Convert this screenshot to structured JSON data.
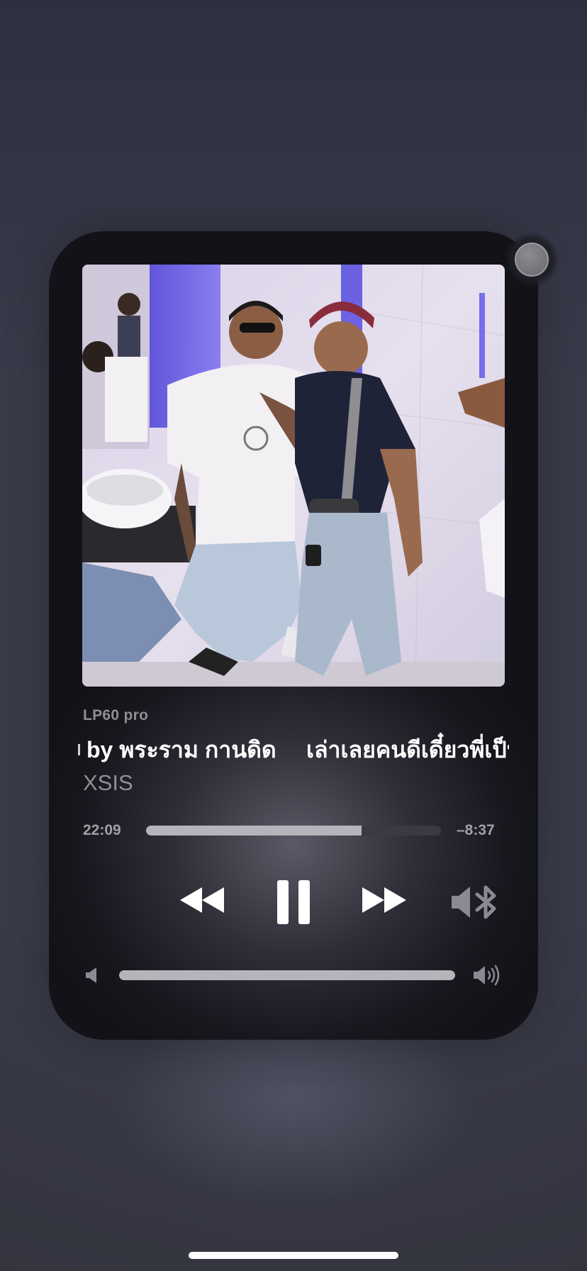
{
  "now_playing": {
    "device_name": "LP60 pro",
    "title": "by พระราม กานดิด",
    "title_continued": "เล่าเลยคนดีเดี๋ยวพี่เป็น",
    "artist": "XSIS",
    "elapsed": "22:09",
    "remaining": "–8:37",
    "progress_fraction": 0.73,
    "volume_fraction": 1.0
  },
  "controls": {
    "rewind_icon": "backward-icon",
    "pause_icon": "pause-icon",
    "forward_icon": "forward-icon",
    "output_icon": "speaker-bluetooth-icon",
    "volume_low_icon": "speaker-low-icon",
    "volume_high_icon": "speaker-high-icon",
    "close_icon": "close-icon"
  },
  "colors": {
    "accent_fill": "#b4b4bb",
    "track": "#3a3a44",
    "text_primary": "#ffffff",
    "text_secondary": "#8f8f96"
  }
}
